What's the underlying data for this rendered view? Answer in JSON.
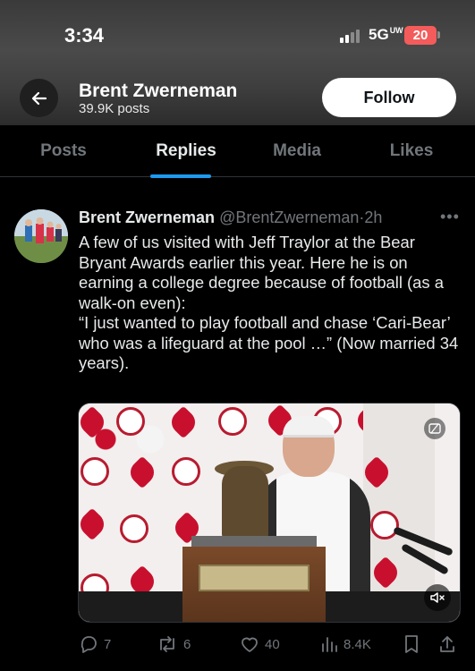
{
  "status_bar": {
    "time": "3:34",
    "network": "5G",
    "network_superscript": "UW",
    "battery": "20"
  },
  "header": {
    "back_icon": "arrow-left-icon",
    "profile_name": "Brent Zwerneman",
    "post_count": "39.9K posts",
    "follow_label": "Follow"
  },
  "tabs": [
    {
      "label": "Posts",
      "active": false
    },
    {
      "label": "Replies",
      "active": true
    },
    {
      "label": "Media",
      "active": false
    },
    {
      "label": "Likes",
      "active": false
    }
  ],
  "tweet": {
    "author_name": "Brent Zwerneman",
    "handle": "@BrentZwerneman",
    "separator": "·",
    "age": "2h",
    "text": "A few of us visited with Jeff Traylor at the Bear Bryant Awards earlier this year. Here he is on earning a college degree because of football (as a walk-on even):\n“I just wanted to play football and chase ‘Cari-Bear’ who was a lifeguard at the pool …” (Now married 34 years).",
    "media": {
      "type": "video",
      "mute_icon": "speaker-muted-icon"
    },
    "actions": {
      "replies": "7",
      "reposts": "6",
      "likes": "40",
      "views": "8.4K"
    }
  },
  "colors": {
    "accent": "#1d9bf0",
    "muted": "#71767b",
    "text": "#e7e9ea",
    "background": "#000000",
    "battery": "#f45b5b"
  }
}
